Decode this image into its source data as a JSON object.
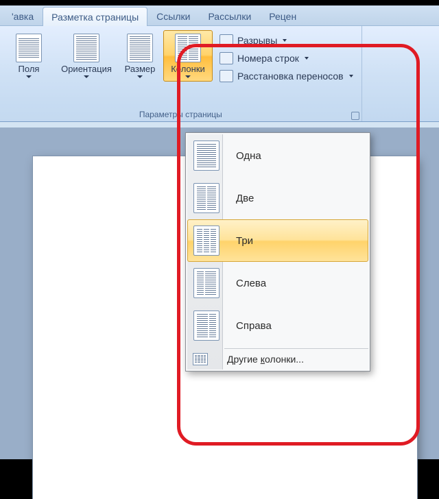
{
  "tabs": {
    "t0": "'авка",
    "t1": "Разметка страницы",
    "t2": "Ссылки",
    "t3": "Рассылки",
    "t4": "Рецен"
  },
  "ribbon": {
    "fields": "Поля",
    "orientation": "Ориентация",
    "size": "Размер",
    "columns": "Колонки",
    "breaks": "Разрывы",
    "line_numbers": "Номера строк",
    "hyphenation": "Расстановка переносов",
    "group_label": "Параметры страницы"
  },
  "menu": {
    "one": "Одна",
    "two": "Две",
    "three": "Три",
    "left": "Слева",
    "right": "Справа",
    "more_pre": "Другие ",
    "more_u": "к",
    "more_post": "олонки..."
  }
}
